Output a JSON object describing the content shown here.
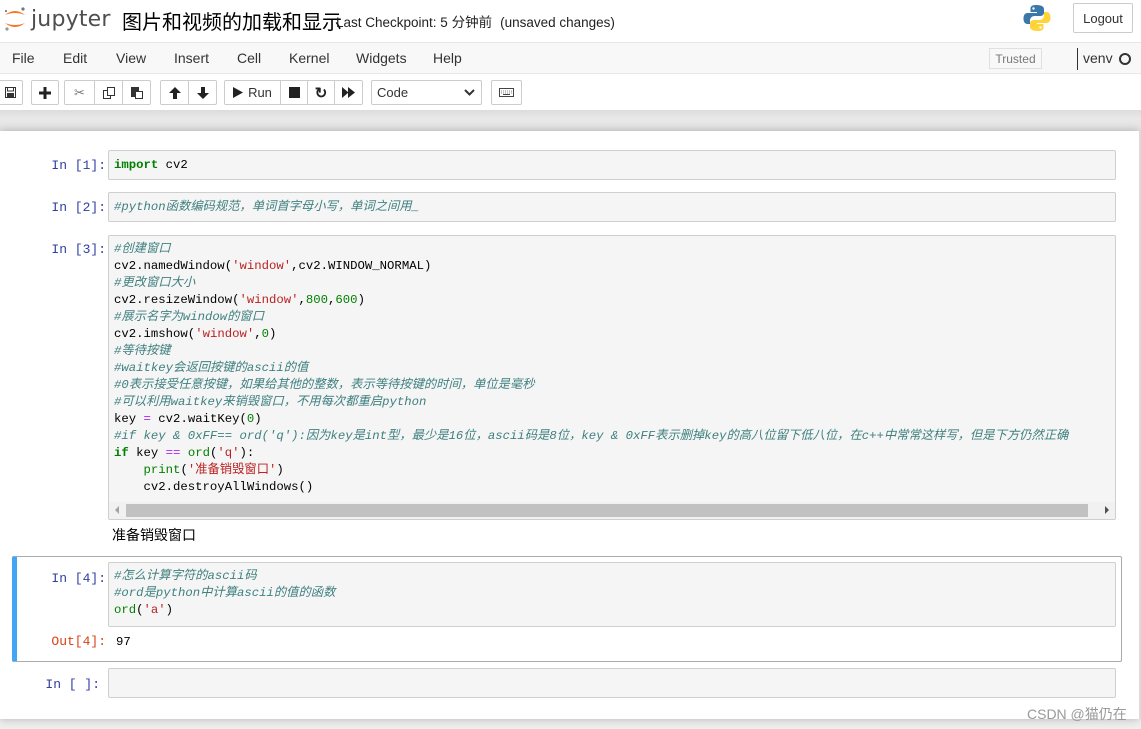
{
  "app": {
    "name": "jupyter",
    "notebook_title": "图片和视频的加载和显示",
    "checkpoint": "Last Checkpoint: 5 分钟前",
    "unsaved": "(unsaved changes)",
    "logout_label": "Logout"
  },
  "menu": {
    "items": [
      "File",
      "Edit",
      "View",
      "Insert",
      "Cell",
      "Kernel",
      "Widgets",
      "Help"
    ],
    "trusted_label": "Trusted",
    "kernel_name": "venv"
  },
  "toolbar": {
    "run_label": "Run",
    "cell_type": "Code"
  },
  "cells": [
    {
      "prompt": "In  [1]:",
      "lines": [
        [
          {
            "t": "kw",
            "v": "import"
          },
          {
            "t": "",
            "v": " cv2"
          }
        ]
      ]
    },
    {
      "prompt": "In  [2]:",
      "lines": [
        [
          {
            "t": "cm",
            "v": "#python函数编码规范，单词首字母小写，单词之间用_"
          }
        ]
      ]
    },
    {
      "prompt": "In  [3]:",
      "lines": [
        [
          {
            "t": "cm",
            "v": "#创建窗口"
          }
        ],
        [
          {
            "t": "",
            "v": "cv2.namedWindow("
          },
          {
            "t": "st",
            "v": "'window'"
          },
          {
            "t": "",
            "v": ",cv2.WINDOW_NORMAL)"
          }
        ],
        [
          {
            "t": "cm",
            "v": "#更改窗口大小"
          }
        ],
        [
          {
            "t": "",
            "v": "cv2.resizeWindow("
          },
          {
            "t": "st",
            "v": "'window'"
          },
          {
            "t": "",
            "v": ","
          },
          {
            "t": "nu",
            "v": "800"
          },
          {
            "t": "",
            "v": ","
          },
          {
            "t": "nu",
            "v": "600"
          },
          {
            "t": "",
            "v": ")"
          }
        ],
        [
          {
            "t": "cm",
            "v": "#展示名字为window的窗口"
          }
        ],
        [
          {
            "t": "",
            "v": "cv2.imshow("
          },
          {
            "t": "st",
            "v": "'window'"
          },
          {
            "t": "",
            "v": ","
          },
          {
            "t": "nu",
            "v": "0"
          },
          {
            "t": "",
            "v": ")"
          }
        ],
        [
          {
            "t": "cm",
            "v": "#等待按键"
          }
        ],
        [
          {
            "t": "cm",
            "v": "#waitkey会返回按键的ascii的值"
          }
        ],
        [
          {
            "t": "cm",
            "v": "#0表示接受任意按键，如果给其他的整数，表示等待按键的时间，单位是毫秒"
          }
        ],
        [
          {
            "t": "cm",
            "v": "#可以利用waitkey来销毁窗口，不用每次都重启python"
          }
        ],
        [
          {
            "t": "",
            "v": "key "
          },
          {
            "t": "op",
            "v": "="
          },
          {
            "t": "",
            "v": " cv2.waitKey("
          },
          {
            "t": "nu",
            "v": "0"
          },
          {
            "t": "",
            "v": ")"
          }
        ],
        [
          {
            "t": "cm",
            "v": "#if key & 0xFF== ord('q'):因为key是int型，最少是16位，ascii码是8位，key & 0xFF表示删掉key的高八位留下低八位，在c++中常常这样写，但是下方仍然正确"
          }
        ],
        [
          {
            "t": "kw",
            "v": "if"
          },
          {
            "t": "",
            "v": " key "
          },
          {
            "t": "op",
            "v": "=="
          },
          {
            "t": "",
            "v": " "
          },
          {
            "t": "bi",
            "v": "ord"
          },
          {
            "t": "",
            "v": "("
          },
          {
            "t": "st",
            "v": "'q'"
          },
          {
            "t": "",
            "v": "):"
          }
        ],
        [
          {
            "t": "",
            "v": "    "
          },
          {
            "t": "bi",
            "v": "print"
          },
          {
            "t": "",
            "v": "("
          },
          {
            "t": "st",
            "v": "'准备销毁窗口'"
          },
          {
            "t": "",
            "v": ")"
          }
        ],
        [
          {
            "t": "",
            "v": "    cv2.destroyAllWindows()"
          }
        ]
      ],
      "stdout": "准备销毁窗口"
    },
    {
      "prompt": "In  [4]:",
      "lines": [
        [
          {
            "t": "cm",
            "v": "#怎么计算字符的ascii码"
          }
        ],
        [
          {
            "t": "cm",
            "v": "#ord是python中计算ascii的值的函数"
          }
        ],
        [
          {
            "t": "bi",
            "v": "ord"
          },
          {
            "t": "",
            "v": "("
          },
          {
            "t": "st",
            "v": "'a'"
          },
          {
            "t": "",
            "v": ")"
          }
        ]
      ],
      "out_prompt": "Out[4]:",
      "result": "97"
    },
    {
      "prompt": "In  [ ]:",
      "lines": []
    }
  ],
  "watermark": "CSDN @猫仍在"
}
